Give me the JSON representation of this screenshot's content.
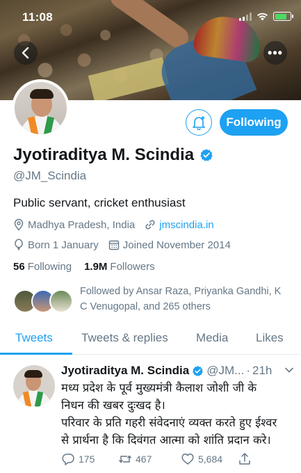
{
  "status_bar": {
    "time": "11:08"
  },
  "colors": {
    "accent": "#1da1f2",
    "secondary_text": "#657786",
    "primary_text": "#14171a"
  },
  "header": {
    "back_icon": "chevron-left-icon",
    "more_icon": "ellipsis-icon",
    "more_label": "•••"
  },
  "profile": {
    "notify_icon": "bell-plus-icon",
    "following_label": "Following",
    "name": "Jyotiraditya M. Scindia",
    "handle": "@JM_Scindia",
    "bio": "Public servant, cricket enthusiast",
    "location": "Madhya Pradesh, India",
    "website": "jmscindia.in",
    "birthday": "Born 1 January",
    "joined": "Joined November 2014",
    "following_count": "56",
    "following_label_text": "Following",
    "followers_count": "1.9M",
    "followers_label_text": "Followers",
    "followed_by": "Followed by Ansar Raza, Priyanka Gandhi, K C Venugopal, and 265 others"
  },
  "tabs": [
    {
      "label": "Tweets",
      "active": true
    },
    {
      "label": "Tweets & replies",
      "active": false
    },
    {
      "label": "Media",
      "active": false
    },
    {
      "label": "Likes",
      "active": false
    }
  ],
  "tweet": {
    "author_name": "Jyotiraditya M. Scindia",
    "author_handle": "@JM...",
    "dot": "·",
    "time": "21h",
    "body_line1": "मध्य प्रदेश के पूर्व मुख्यमंत्री कैलाश जोशी जी के",
    "body_line2": "निधन की खबर दुःखद है।",
    "body_line3": "परिवार के प्रति गहरी संवेदनाएं व्यक्त करते हुए ईश्वर",
    "body_line4": "से प्रार्थना है कि दिवंगत आत्मा को शांति प्रदान करे।",
    "replies": "175",
    "retweets": "467",
    "likes": "5,684"
  }
}
